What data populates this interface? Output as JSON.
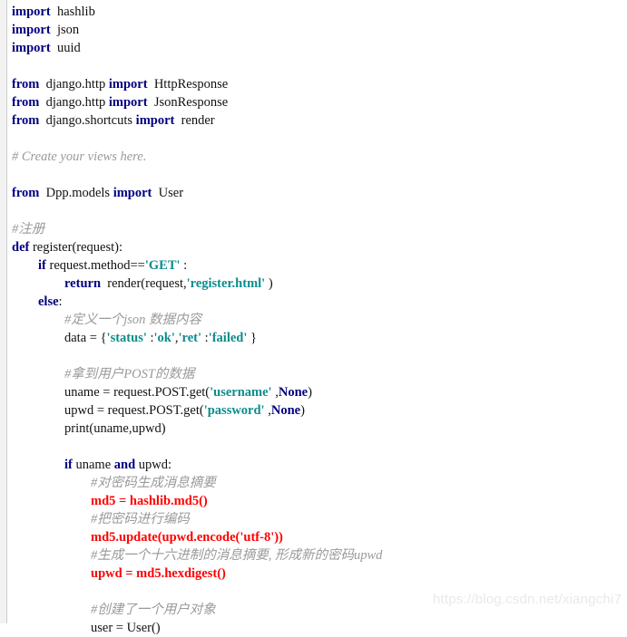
{
  "document": {
    "kind": "python-source-screenshot",
    "language": "Python",
    "watermark": "https://blog.csdn.net/xiangchi7",
    "colors": {
      "background": "#ffffff",
      "text": "#111111",
      "keyword": "#000080",
      "string": "#0c8c8c",
      "comment": "#9a9a9a",
      "error": "#ff0000",
      "gutter": "#f2f2f2",
      "gutter_rule": "#cccccc",
      "watermark": "#e9e9e9"
    }
  },
  "code": {
    "lines": [
      {
        "indent": 0,
        "tokens": [
          {
            "t": "kw",
            "s": "import"
          },
          {
            "t": "plain",
            "s": "  hashlib"
          }
        ]
      },
      {
        "indent": 0,
        "tokens": [
          {
            "t": "kw",
            "s": "import"
          },
          {
            "t": "plain",
            "s": "  json"
          }
        ]
      },
      {
        "indent": 0,
        "tokens": [
          {
            "t": "kw",
            "s": "import"
          },
          {
            "t": "plain",
            "s": "  uuid"
          }
        ]
      },
      {
        "indent": 0,
        "tokens": []
      },
      {
        "indent": 0,
        "tokens": [
          {
            "t": "kw",
            "s": "from"
          },
          {
            "t": "plain",
            "s": "  django.http "
          },
          {
            "t": "kw",
            "s": "import"
          },
          {
            "t": "plain",
            "s": "  HttpResponse"
          }
        ]
      },
      {
        "indent": 0,
        "tokens": [
          {
            "t": "kw",
            "s": "from"
          },
          {
            "t": "plain",
            "s": "  django.http "
          },
          {
            "t": "kw",
            "s": "import"
          },
          {
            "t": "plain",
            "s": "  JsonResponse"
          }
        ]
      },
      {
        "indent": 0,
        "tokens": [
          {
            "t": "kw",
            "s": "from"
          },
          {
            "t": "plain",
            "s": "  django.shortcuts "
          },
          {
            "t": "kw",
            "s": "import"
          },
          {
            "t": "plain",
            "s": "  render"
          }
        ]
      },
      {
        "indent": 0,
        "tokens": []
      },
      {
        "indent": 0,
        "tokens": [
          {
            "t": "comment",
            "s": "# Create your views here."
          }
        ]
      },
      {
        "indent": 0,
        "tokens": []
      },
      {
        "indent": 0,
        "tokens": [
          {
            "t": "kw",
            "s": "from"
          },
          {
            "t": "plain",
            "s": "  Dpp.models "
          },
          {
            "t": "kw",
            "s": "import"
          },
          {
            "t": "plain",
            "s": "  User"
          }
        ]
      },
      {
        "indent": 0,
        "tokens": []
      },
      {
        "indent": 0,
        "tokens": [
          {
            "t": "comment",
            "s": "#注册"
          }
        ]
      },
      {
        "indent": 0,
        "tokens": [
          {
            "t": "kw",
            "s": "def"
          },
          {
            "t": "plain",
            "s": " register(request):"
          }
        ]
      },
      {
        "indent": 1,
        "tokens": [
          {
            "t": "kw",
            "s": "if"
          },
          {
            "t": "plain",
            "s": " request.method=="
          },
          {
            "t": "str",
            "s": "'GET'"
          },
          {
            "t": "plain",
            "s": " :"
          }
        ]
      },
      {
        "indent": 2,
        "tokens": [
          {
            "t": "kw",
            "s": "return"
          },
          {
            "t": "plain",
            "s": "  render(request,"
          },
          {
            "t": "str",
            "s": "'register.html'"
          },
          {
            "t": "plain",
            "s": " )"
          }
        ]
      },
      {
        "indent": 1,
        "tokens": [
          {
            "t": "kw",
            "s": "else"
          },
          {
            "t": "plain",
            "s": ":"
          }
        ]
      },
      {
        "indent": 2,
        "tokens": [
          {
            "t": "comment",
            "s": "#定义一个json 数据内容"
          }
        ]
      },
      {
        "indent": 2,
        "tokens": [
          {
            "t": "plain",
            "s": "data = {"
          },
          {
            "t": "str",
            "s": "'status'"
          },
          {
            "t": "plain",
            "s": " :"
          },
          {
            "t": "str",
            "s": "'ok'"
          },
          {
            "t": "plain",
            "s": ","
          },
          {
            "t": "str",
            "s": "'ret'"
          },
          {
            "t": "plain",
            "s": " :"
          },
          {
            "t": "str",
            "s": "'failed'"
          },
          {
            "t": "plain",
            "s": " }"
          }
        ]
      },
      {
        "indent": 2,
        "tokens": []
      },
      {
        "indent": 2,
        "tokens": [
          {
            "t": "comment",
            "s": "#拿到用户POST的数据"
          }
        ]
      },
      {
        "indent": 2,
        "tokens": [
          {
            "t": "plain",
            "s": "uname = request.POST.get("
          },
          {
            "t": "str",
            "s": "'username'"
          },
          {
            "t": "plain",
            "s": " ,"
          },
          {
            "t": "builtin",
            "s": "None"
          },
          {
            "t": "plain",
            "s": ")"
          }
        ]
      },
      {
        "indent": 2,
        "tokens": [
          {
            "t": "plain",
            "s": "upwd = request.POST.get("
          },
          {
            "t": "str",
            "s": "'password'"
          },
          {
            "t": "plain",
            "s": " ,"
          },
          {
            "t": "builtin",
            "s": "None"
          },
          {
            "t": "plain",
            "s": ")"
          }
        ]
      },
      {
        "indent": 2,
        "tokens": [
          {
            "t": "plain",
            "s": "print(uname,upwd)"
          }
        ]
      },
      {
        "indent": 2,
        "tokens": []
      },
      {
        "indent": 2,
        "tokens": [
          {
            "t": "kw",
            "s": "if"
          },
          {
            "t": "plain",
            "s": " uname "
          },
          {
            "t": "kw",
            "s": "and"
          },
          {
            "t": "plain",
            "s": " upwd:"
          }
        ]
      },
      {
        "indent": 3,
        "tokens": [
          {
            "t": "comment",
            "s": "#对密码生成消息摘要"
          }
        ]
      },
      {
        "indent": 3,
        "tokens": [
          {
            "t": "err",
            "s": "md5 = hashlib.md5()"
          }
        ]
      },
      {
        "indent": 3,
        "tokens": [
          {
            "t": "comment",
            "s": "#把密码进行编码"
          }
        ]
      },
      {
        "indent": 3,
        "tokens": [
          {
            "t": "err",
            "s": "md5.update(upwd.encode("
          },
          {
            "t": "errstr",
            "s": "'utf-8'"
          },
          {
            "t": "err",
            "s": "))"
          }
        ]
      },
      {
        "indent": 3,
        "tokens": [
          {
            "t": "comment",
            "s": "#生成一个十六进制的消息摘要, 形成新的密码upwd"
          }
        ]
      },
      {
        "indent": 3,
        "tokens": [
          {
            "t": "err",
            "s": "upwd = md5.hexdigest()"
          }
        ]
      },
      {
        "indent": 3,
        "tokens": []
      },
      {
        "indent": 3,
        "tokens": [
          {
            "t": "comment",
            "s": "#创建了一个用户对象"
          }
        ]
      },
      {
        "indent": 3,
        "tokens": [
          {
            "t": "plain",
            "s": "user = User()"
          }
        ]
      }
    ]
  }
}
